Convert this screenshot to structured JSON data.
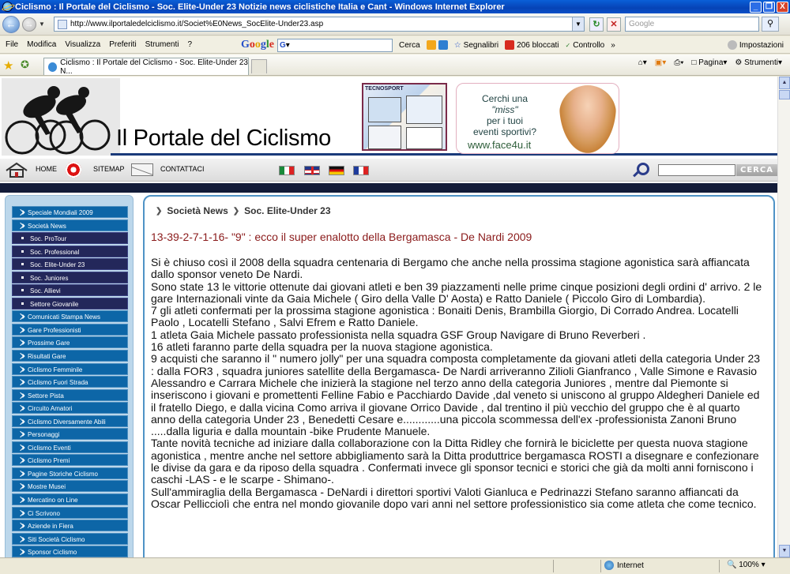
{
  "window": {
    "title": "Ciclismo : Il Portale del Ciclismo - Soc. Elite-Under 23 Notizie news ciclistiche Italia e Cant - Windows Internet Explorer",
    "controls": [
      "_",
      "❐",
      "X"
    ]
  },
  "navbar": {
    "address": "http://www.ilportaledelciclismo.it/Societ%E0News_SocElite-Under23.asp",
    "search_placeholder": "Google"
  },
  "menubar": {
    "items": [
      "File",
      "Modifica",
      "Visualizza",
      "Preferiti",
      "Strumenti",
      "?"
    ],
    "google_toolbar": {
      "search_label": "Cerca",
      "bookmarks_label": "Segnalibri",
      "blocked_label": "206 bloccati",
      "spellcheck_label": "Controllo",
      "more_label": "»",
      "settings_label": "Impostazioni"
    }
  },
  "favbar": {
    "tab_title": "Ciclismo : Il Portale del Ciclismo - Soc. Elite-Under 23 N...",
    "page_menu": "Pagina",
    "tools_menu": "Strumenti"
  },
  "site": {
    "logo_text": "Il Portale del Ciclismo",
    "banner1_text": "TECNOSPORT",
    "banner2": {
      "line1": "Cerchi una",
      "line2": "\"miss\"",
      "line3": "per i tuoi",
      "line4": "eventi sportivi?",
      "url": "www.face4u.it"
    },
    "topnav": {
      "home": "HOME",
      "sitemap": "SITEMAP",
      "contact": "CONTATTACI",
      "search_button": "CERCA"
    },
    "sidebar": [
      {
        "label": "Speciale Mondiali 2009",
        "sub": false
      },
      {
        "label": "Società News",
        "sub": false
      },
      {
        "label": "Soc. ProTour",
        "sub": true
      },
      {
        "label": "Soc. Professional",
        "sub": true
      },
      {
        "label": "Soc. Elite-Under 23",
        "sub": true
      },
      {
        "label": "Soc. Juniores",
        "sub": true
      },
      {
        "label": "Soc. Allievi",
        "sub": true
      },
      {
        "label": "Settore Giovanile",
        "sub": true
      },
      {
        "label": "Comunicati Stampa News",
        "sub": false
      },
      {
        "label": "Gare Professionisti",
        "sub": false
      },
      {
        "label": "Prossime Gare",
        "sub": false
      },
      {
        "label": "Risultati Gare",
        "sub": false
      },
      {
        "label": "Ciclismo Femminile",
        "sub": false
      },
      {
        "label": "Ciclismo Fuori Strada",
        "sub": false
      },
      {
        "label": "Settore Pista",
        "sub": false
      },
      {
        "label": "Circuito Amatori",
        "sub": false
      },
      {
        "label": "Ciclismo Diversamente Abili",
        "sub": false
      },
      {
        "label": "Personaggi",
        "sub": false
      },
      {
        "label": "Ciclismo Eventi",
        "sub": false
      },
      {
        "label": "Ciclismo Premi",
        "sub": false
      },
      {
        "label": "Pagine Storiche Ciclismo",
        "sub": false
      },
      {
        "label": "Mostre Musei",
        "sub": false
      },
      {
        "label": "Mercatino on Line",
        "sub": false
      },
      {
        "label": "Ci Scrivono",
        "sub": false
      },
      {
        "label": "Aziende in Fiera",
        "sub": false
      },
      {
        "label": "Siti Società Ciclismo",
        "sub": false
      },
      {
        "label": "Sponsor Ciclismo",
        "sub": false
      }
    ],
    "breadcrumb": [
      "Società News",
      "Soc. Elite-Under 23"
    ],
    "article_title": "13-39-2-7-1-16- \"9\" : ecco il super enalotto della Bergamasca - De Nardi 2009",
    "article_body": [
      "Si è chiuso così il 2008 della squadra centenaria di Bergamo che anche nella prossima stagione agonistica sarà affiancata dallo sponsor veneto De Nardi.",
      "Sono state 13 le vittorie ottenute dai giovani atleti e ben 39 piazzamenti nelle prime cinque posizioni degli ordini d' arrivo. 2 le gare Internazionali vinte da Gaia Michele ( Giro della Valle D' Aosta) e Ratto Daniele ( Piccolo Giro di Lombardia).",
      "7 gli atleti confermati per la prossima stagione agonistica : Bonaiti Denis, Brambilla Giorgio, Di Corrado Andrea. Locatelli Paolo , Locatelli Stefano , Salvi Efrem e Ratto Daniele.",
      "1 atleta Gaia Michele passato professionista nella squadra GSF Group Navigare di Bruno Reverberi .",
      "16 atleti faranno parte della squadra per la nuova stagione agonistica.",
      "9 acquisti che saranno il \" numero jolly\" per una squadra composta completamente da giovani atleti della categoria Under 23 : dalla FOR3 , squadra juniores satellite della Bergamasca- De Nardi arriveranno Zilioli Gianfranco , Valle Simone e Ravasio Alessandro e Carrara Michele che inizierà la stagione nel terzo anno della categoria Juniores , mentre dal Piemonte si inseriscono i giovani e promettenti Felline Fabio e Pacchiardo Davide ,dal veneto si uniscono al gruppo Aldegheri Daniele ed il fratello Diego, e dalla vicina Como arriva il giovane Orrico Davide , dal trentino il più vecchio del gruppo che è al quarto anno della categoria Under 23 , Benedetti Cesare e............una piccola scommessa dell'ex -professionista Zanoni Bruno .....dalla liguria e dalla mountain -bike Prudente Manuele.",
      "Tante novità tecniche ad iniziare dalla collaborazione con la Ditta Ridley che fornirà le biciclette per questa nuova stagione agonistica , mentre anche nel settore abbigliamento sarà la Ditta produttrice bergamasca ROSTI a disegnare e confezionare le divise da gara e da riposo della squadra . Confermati invece gli sponsor tecnici e storici che già da molti anni forniscono i caschi -LAS - e le scarpe - Shimano-.",
      "Sull'ammiraglia della Bergamasca - DeNardi i direttori sportivi Valoti Gianluca e Pedrinazzi Stefano saranno affiancati da Oscar Pellicciolì che entra nel mondo giovanile dopo vari anni nel settore professionistico sia come atleta che come tecnico."
    ]
  },
  "statusbar": {
    "zone": "Internet",
    "zoom": "100%"
  }
}
